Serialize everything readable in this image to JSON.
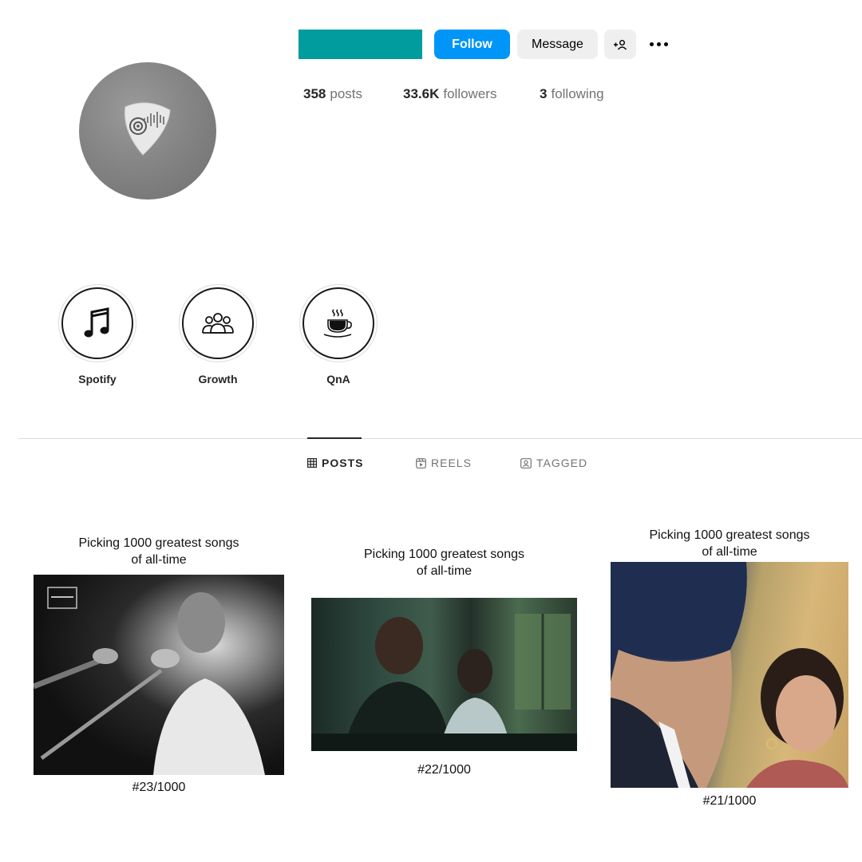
{
  "profile": {
    "follow_label": "Follow",
    "message_label": "Message"
  },
  "stats": {
    "posts_count": "358",
    "posts_label": "posts",
    "followers_count": "33.6K",
    "followers_label": "followers",
    "following_count": "3",
    "following_label": "following"
  },
  "highlights": [
    {
      "label": "Spotify",
      "icon": "music-note-icon"
    },
    {
      "label": "Growth",
      "icon": "people-group-icon"
    },
    {
      "label": "QnA",
      "icon": "coffee-cup-icon"
    }
  ],
  "tabs": [
    {
      "label": "POSTS",
      "icon": "grid-icon",
      "active": true
    },
    {
      "label": "REELS",
      "icon": "reels-icon",
      "active": false
    },
    {
      "label": "TAGGED",
      "icon": "tagged-icon",
      "active": false
    }
  ],
  "posts": [
    {
      "caption_line1": "Picking 1000 greatest songs",
      "caption_line2": "of all-time",
      "number": "#23/1000"
    },
    {
      "caption_line1": "Picking 1000 greatest songs",
      "caption_line2": "of all-time",
      "number": "#22/1000"
    },
    {
      "caption_line1": "Picking 1000 greatest songs",
      "caption_line2": "of all-time",
      "number": "#21/1000"
    }
  ],
  "colors": {
    "follow_blue": "#0095f6",
    "username_bar": "#009c9e"
  }
}
